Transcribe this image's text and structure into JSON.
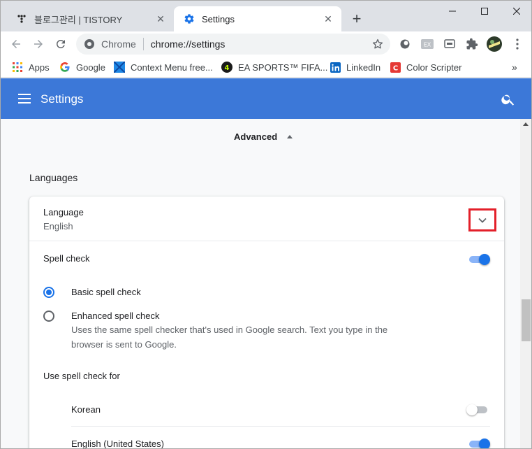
{
  "tabs": [
    {
      "title": "블로그관리 | TISTORY",
      "icon": "tistory-icon",
      "active": false
    },
    {
      "title": "Settings",
      "icon": "gear-icon",
      "active": true
    }
  ],
  "omnibox": {
    "chip": "Chrome",
    "url": "chrome://settings"
  },
  "bookmarks": [
    {
      "label": "Apps",
      "icon": "apps-grid-icon"
    },
    {
      "label": "Google",
      "icon": "google-icon"
    },
    {
      "label": "Context Menu free...",
      "icon": "context-menu-icon"
    },
    {
      "label": "EA SPORTS™ FIFA...",
      "icon": "fifa-icon"
    },
    {
      "label": "LinkedIn",
      "icon": "linkedin-icon"
    },
    {
      "label": "Color Scripter",
      "icon": "color-scripter-icon"
    }
  ],
  "header": {
    "title": "Settings"
  },
  "advanced": {
    "label": "Advanced"
  },
  "section": {
    "title": "Languages"
  },
  "language": {
    "label": "Language",
    "value": "English"
  },
  "spell": {
    "label": "Spell check",
    "enabled": true,
    "basic_label": "Basic spell check",
    "enhanced_label": "Enhanced spell check",
    "enhanced_desc": "Uses the same spell checker that's used in Google search. Text you type in the browser is sent to Google.",
    "selected": "basic"
  },
  "use_for": {
    "title": "Use spell check for",
    "languages": [
      {
        "name": "Korean",
        "enabled": false
      },
      {
        "name": "English (United States)",
        "enabled": true
      }
    ]
  },
  "colors": {
    "header": "#3c78d8",
    "accent": "#1a73e8",
    "highlight": "#e3202a"
  }
}
